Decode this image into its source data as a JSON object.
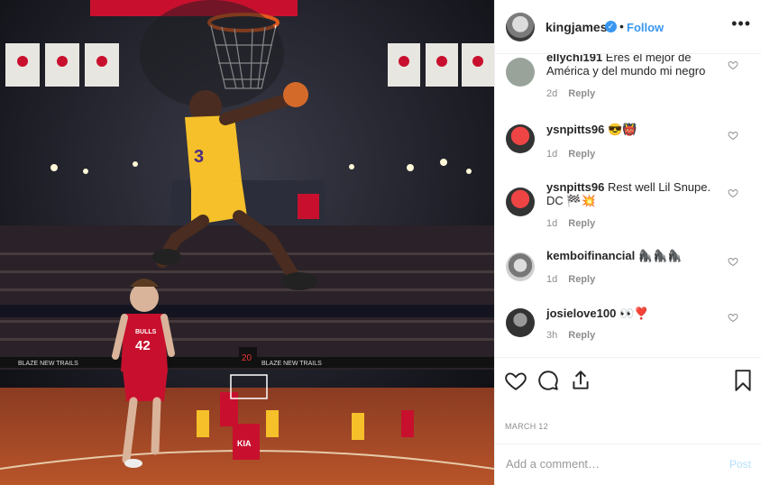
{
  "header": {
    "username": "kingjames",
    "separator": "•",
    "follow_label": "Follow",
    "more_label": "•••",
    "verified_glyph": "✓"
  },
  "comments": [
    {
      "user": "ellychi191",
      "text": "Eres el mejor de América y del mundo mi negro",
      "age": "2d",
      "reply": "Reply",
      "avatar_color": "#9aa39a"
    },
    {
      "user": "ysnpitts96",
      "text": "😎👹",
      "age": "1d",
      "reply": "Reply",
      "avatar_color": "#a33"
    },
    {
      "user": "ysnpitts96",
      "text": "Rest well Lil Snupe. DC 🏁💥",
      "age": "1d",
      "reply": "Reply",
      "avatar_color": "#a33"
    },
    {
      "user": "kemboifinancial",
      "text": "🦍🦍🦍",
      "age": "1d",
      "reply": "Reply",
      "avatar_color": "#cfcfcf"
    },
    {
      "user": "josielove100",
      "text": "👀❣️",
      "age": "3h",
      "reply": "Reply",
      "avatar_color": "#444"
    }
  ],
  "date": "MARCH 12",
  "add_comment": {
    "placeholder": "Add a comment…",
    "post_label": "Post"
  },
  "icons": [
    "heart-icon",
    "comment-icon",
    "share-icon",
    "bookmark-icon"
  ],
  "photo": {
    "banner_text": "BLAZE NEW TRAILS",
    "player1_number": "42",
    "player1_team": "BULLS",
    "player2_number": "3",
    "sponsor": "KIA",
    "shot_clock": "20"
  },
  "colors": {
    "accent": "#3897f0",
    "lakers_gold": "#f5c02a",
    "bulls_red": "#c8102e"
  }
}
